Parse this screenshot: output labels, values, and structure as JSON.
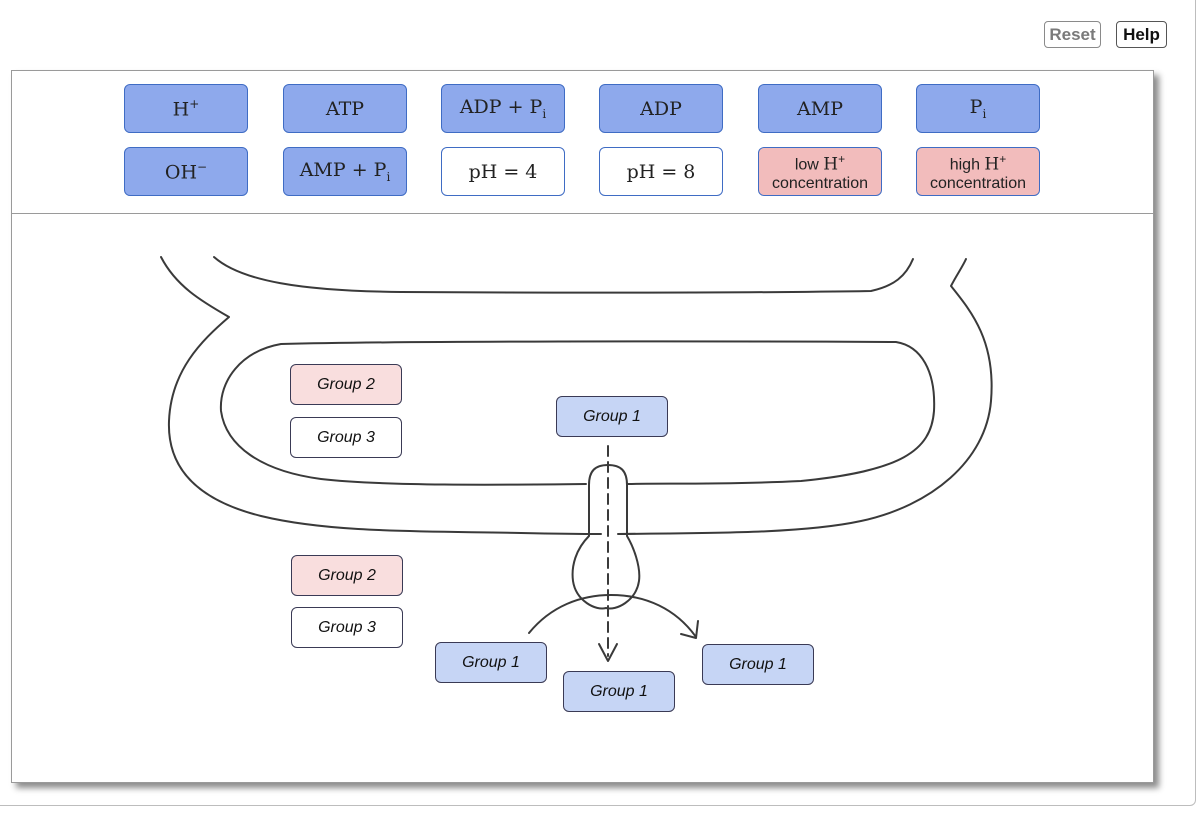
{
  "toolbar": {
    "reset_label": "Reset",
    "help_label": "Help"
  },
  "palette": {
    "row1": [
      {
        "id": "h-plus",
        "base": "H",
        "sup": "+",
        "sub": "",
        "style": "blue"
      },
      {
        "id": "atp",
        "base": "ATP",
        "sup": "",
        "sub": "",
        "style": "blue"
      },
      {
        "id": "adp-pi",
        "base": "ADP + P",
        "sup": "",
        "sub": "i",
        "style": "blue"
      },
      {
        "id": "adp",
        "base": "ADP",
        "sup": "",
        "sub": "",
        "style": "blue"
      },
      {
        "id": "amp",
        "base": "AMP",
        "sup": "",
        "sub": "",
        "style": "blue"
      },
      {
        "id": "pi",
        "base": "P",
        "sup": "",
        "sub": "i",
        "style": "blue"
      }
    ],
    "row2": [
      {
        "id": "oh-minus",
        "base": "OH",
        "sup": "−",
        "sub": "",
        "style": "blue"
      },
      {
        "id": "amp-pi",
        "base": "AMP + P",
        "sup": "",
        "sub": "i",
        "style": "blue"
      },
      {
        "id": "ph-4",
        "base": "pH = 4",
        "sup": "",
        "sub": "",
        "style": "white"
      },
      {
        "id": "ph-8",
        "base": "pH = 8",
        "sup": "",
        "sub": "",
        "style": "white"
      },
      {
        "id": "low-h",
        "prefix": "low ",
        "base": "H",
        "sup": "+",
        "line2": "concentration",
        "style": "pink"
      },
      {
        "id": "high-h",
        "prefix": "high ",
        "base": "H",
        "sup": "+",
        "line2": "concentration",
        "style": "pink"
      }
    ]
  },
  "drop_targets": [
    {
      "label": "Group 2",
      "group": "g2",
      "region": "inner-compartment"
    },
    {
      "label": "Group 3",
      "group": "g3",
      "region": "inner-compartment"
    },
    {
      "label": "Group 1",
      "group": "g1",
      "region": "channel-top"
    },
    {
      "label": "Group 2",
      "group": "g2",
      "region": "outer-space"
    },
    {
      "label": "Group 3",
      "group": "g3",
      "region": "outer-space"
    },
    {
      "label": "Group 1",
      "group": "g1",
      "region": "arrow-left"
    },
    {
      "label": "Group 1",
      "group": "g1",
      "region": "arrow-center"
    },
    {
      "label": "Group 1",
      "group": "g1",
      "region": "arrow-right"
    }
  ],
  "colors": {
    "tile_blue": "#8ea9ec",
    "tile_pink": "#f2bcbc",
    "tile_border": "#3f6cc4",
    "group1_fill": "#c6d5f5",
    "group2_fill": "#f9dede",
    "group3_fill": "#ffffff"
  }
}
